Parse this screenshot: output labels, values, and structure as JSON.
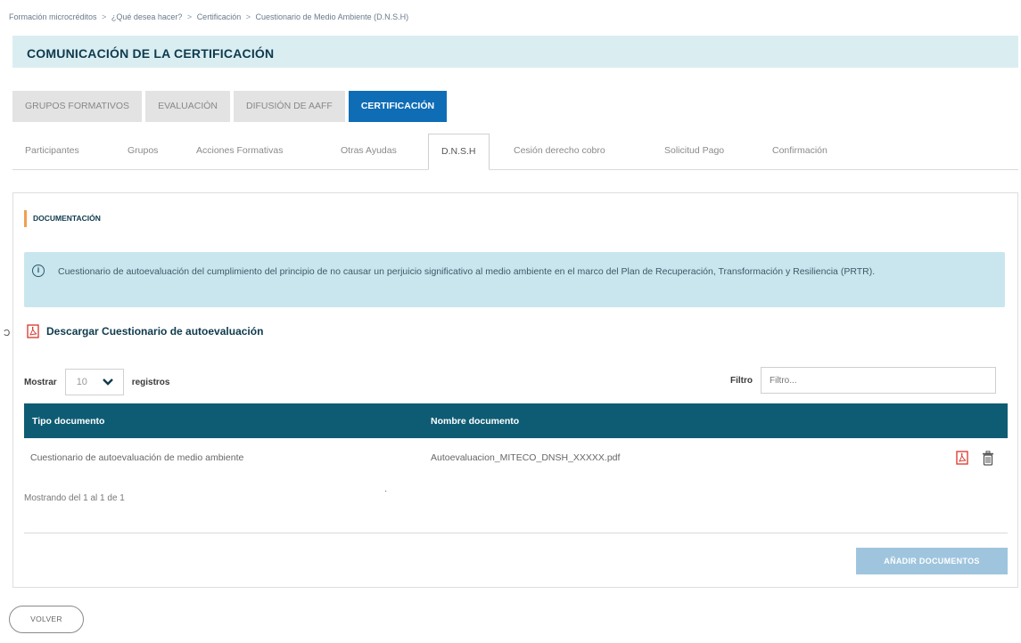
{
  "breadcrumb": {
    "items": [
      "Formación microcréditos",
      "¿Qué desea hacer?",
      "Certificación",
      "Cuestionario de Medio Ambiente (D.N.S.H)"
    ],
    "separator": ">"
  },
  "page": {
    "title": "COMUNICACIÓN DE LA CERTIFICACIÓN"
  },
  "main_tabs": [
    {
      "label": "GRUPOS FORMATIVOS",
      "active": false
    },
    {
      "label": "EVALUACIÓN",
      "active": false
    },
    {
      "label": "DIFUSIÓN DE AAFF",
      "active": false
    },
    {
      "label": "CERTIFICACIÓN",
      "active": true
    }
  ],
  "sub_tabs": [
    {
      "label": "Participantes",
      "active": false
    },
    {
      "label": "Grupos",
      "active": false
    },
    {
      "label": "Acciones Formativas",
      "active": false
    },
    {
      "label": "Otras Ayudas",
      "active": false
    },
    {
      "label": "D.N.S.H",
      "active": true
    },
    {
      "label": "Cesión derecho cobro",
      "active": false
    },
    {
      "label": "Solicitud Pago",
      "active": false
    },
    {
      "label": "Confirmación",
      "active": false
    }
  ],
  "section": {
    "title": "DOCUMENTACIÓN"
  },
  "info": {
    "icon": "info-circle-icon",
    "text": "Cuestionario de autoevaluación del cumplimiento del principio de no causar un perjuicio significativo al medio ambiente en el marco del Plan de Recuperación, Transformación y Resiliencia (PRTR)."
  },
  "side_mark": "Ɔ",
  "download": {
    "label": "Descargar Cuestionario de autoevaluación",
    "icon": "pdf-icon"
  },
  "table_controls": {
    "show_label": "Mostrar",
    "page_size": "10",
    "records_label": "registros",
    "filter_label": "Filtro",
    "filter_placeholder": "Filtro..."
  },
  "table": {
    "headers": [
      "Tipo documento",
      "Nombre documento"
    ],
    "rows": [
      {
        "tipo": "Cuestionario de autoevaluación de medio ambiente",
        "nombre": "Autoevaluacion_MITECO_DNSH_XXXXX.pdf",
        "actions": [
          "pdf-icon",
          "trash-icon"
        ]
      }
    ],
    "footer": "Mostrando del 1 al 1 de 1"
  },
  "stray_dot": "·",
  "buttons": {
    "add": "AÑADIR DOCUMENTOS",
    "back": "VOLVER"
  },
  "colors": {
    "primary": "#0f6db6",
    "header_teal": "#0e5c74",
    "title_bg": "#daeef2",
    "info_bg": "#c9e6ef",
    "accent_orange": "#f0a050",
    "pdf_red": "#d9342b",
    "button_disabled": "#9fc5de"
  }
}
